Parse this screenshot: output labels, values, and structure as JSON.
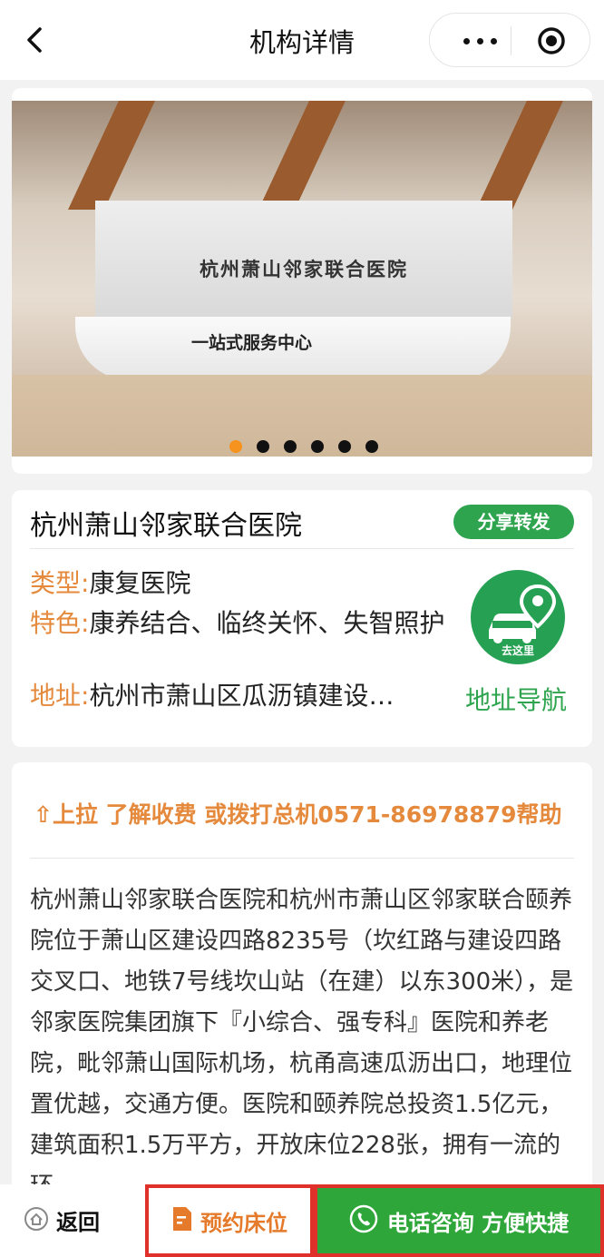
{
  "header": {
    "title": "机构详情",
    "back_icon": "chevron-left-icon",
    "more_icon": "more-dots-icon",
    "close_icon": "target-icon"
  },
  "banner": {
    "wall_text": "杭州萧山邻家联合医院",
    "desk_text": "一站式服务中心",
    "slide_count": 6,
    "active_index": 0,
    "active_color": "#f5931e"
  },
  "institution": {
    "name": "杭州萧山邻家联合医院",
    "share_label": "分享转发",
    "type_label": "类型:",
    "type_value": "康复医院",
    "feature_label": "特色:",
    "feature_value": "康养结合、临终关怀、失智照护",
    "address_label": "地址:",
    "address_value": "杭州市萧山区瓜沥镇建设…",
    "nav_icon_caption": "去这里",
    "nav_label": "地址导航"
  },
  "description": {
    "tip": "⇧上拉 了解收费 或拨打总机0571-86978879帮助",
    "text": "杭州萧山邻家联合医院和杭州市萧山区邻家联合颐养院位于萧山区建设四路8235号（坎红路与建设四路交叉口、地铁7号线坎山站（在建）以东300米），是邻家医院集团旗下『小综合、强专科』医院和养老院，毗邻萧山国际机场，杭甬高速瓜沥出口，地理位置优越，交通方便。医院和颐养院总投资1.5亿元，建筑面积1.5万平方，开放床位228张，拥有一流的环"
  },
  "bottom_bar": {
    "back_label": "返回",
    "reserve_label": "预约床位",
    "phone_label": "电话咨询 方便快捷"
  },
  "colors": {
    "accent_orange": "#e58a3c",
    "brand_green": "#2ea44f",
    "highlight_red": "#e0302a"
  }
}
